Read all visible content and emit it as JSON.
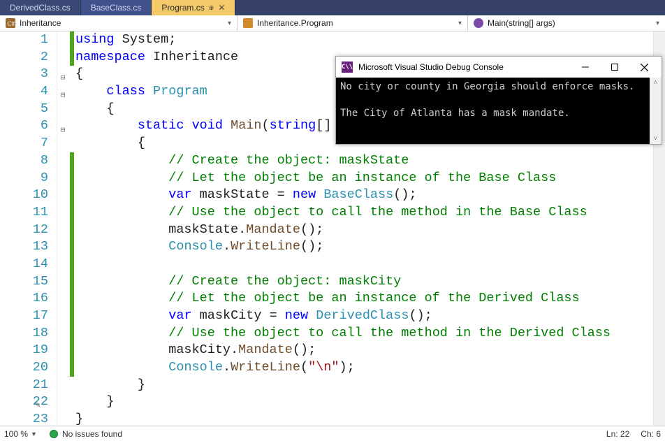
{
  "tabs": [
    {
      "label": "DerivedClass.cs",
      "active": false
    },
    {
      "label": "BaseClass.cs",
      "active": false
    },
    {
      "label": "Program.cs",
      "active": true
    }
  ],
  "nav": {
    "seg1": {
      "icon": "csharp-icon",
      "label": "Inheritance"
    },
    "seg2": {
      "icon": "class-icon",
      "label": "Inheritance.Program"
    },
    "seg3": {
      "icon": "method-icon",
      "label": "Main(string[] args)"
    }
  },
  "code": {
    "lines": [
      {
        "n": 1,
        "html": "<span class='kw'>using</span> System;"
      },
      {
        "n": 2,
        "html": "<span class='kw'>namespace</span> <span class=''>Inheritance</span>"
      },
      {
        "n": 3,
        "html": "{"
      },
      {
        "n": 4,
        "html": "    <span class='kw'>class</span> <span class='type'>Program</span>"
      },
      {
        "n": 5,
        "html": "    {"
      },
      {
        "n": 6,
        "html": "        <span class='kw'>static</span> <span class='kw'>void</span> <span class='ident'>Main</span>(<span class='kw'>string</span>[] <span class='param'>args</span>)"
      },
      {
        "n": 7,
        "html": "        {"
      },
      {
        "n": 8,
        "html": "            <span class='cm'>// Create the object: maskState</span>"
      },
      {
        "n": 9,
        "html": "            <span class='cm'>// Let the object be an instance of the Base Class</span>"
      },
      {
        "n": 10,
        "html": "            <span class='kw'>var</span> <span class=''>maskState</span> = <span class='kw'>new</span> <span class='type'>BaseClass</span>();"
      },
      {
        "n": 11,
        "html": "            <span class='cm'>// Use the object to call the method in the Base Class</span>"
      },
      {
        "n": 12,
        "html": "            maskState.<span class='ident'>Mandate</span>();"
      },
      {
        "n": 13,
        "html": "            <span class='type'>Console</span>.<span class='ident'>WriteLine</span>();"
      },
      {
        "n": 14,
        "html": ""
      },
      {
        "n": 15,
        "html": "            <span class='cm'>// Create the object: maskCity</span>"
      },
      {
        "n": 16,
        "html": "            <span class='cm'>// Let the object be an instance of the Derived Class</span>"
      },
      {
        "n": 17,
        "html": "            <span class='kw'>var</span> <span class=''>maskCity</span> = <span class='kw'>new</span> <span class='type'>DerivedClass</span>();"
      },
      {
        "n": 18,
        "html": "            <span class='cm'>// Use the object to call the method in the Derived Class</span>"
      },
      {
        "n": 19,
        "html": "            maskCity.<span class='ident'>Mandate</span>();"
      },
      {
        "n": 20,
        "html": "            <span class='type'>Console</span>.<span class='ident'>WriteLine</span>(<span class='str'>\"\\n\"</span>);"
      },
      {
        "n": 21,
        "html": "        }"
      },
      {
        "n": 22,
        "html": "    }"
      },
      {
        "n": 23,
        "html": "}"
      }
    ],
    "outline_boxes": [
      3,
      4,
      6
    ],
    "change_marks": [
      {
        "from": 1,
        "to": 2
      },
      {
        "from": 8,
        "to": 20
      }
    ],
    "edit_line": 22
  },
  "console": {
    "title": "Microsoft Visual Studio Debug Console",
    "output": "No city or county in Georgia should enforce masks.\n\nThe City of Atlanta has a mask mandate."
  },
  "status": {
    "zoom": "100 %",
    "issues": "No issues found",
    "ln_label": "Ln:",
    "ln": "22",
    "ch_label": "Ch:",
    "ch": "6"
  }
}
